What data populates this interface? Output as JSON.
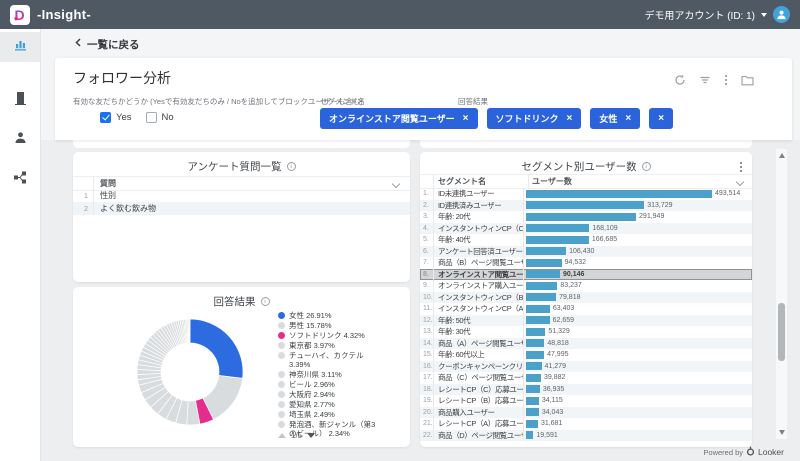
{
  "header": {
    "brand": "-Insight-",
    "account": "デモ用アカウント (ID: 1)"
  },
  "back_link": "一覧に戻る",
  "page": {
    "title": "フォロワー分析"
  },
  "filters": {
    "friend_label": "有効な友だちかどうか (Yesで有効友だちのみ / Noを追加してブロックユーザーも含む)",
    "yes_label": "Yes",
    "no_label": "No",
    "segment_label": "セグメント名",
    "answer_label": "回答結果",
    "chip_color": "#2a63da",
    "chip_close": "×",
    "chips": [
      {
        "label": "オンラインストア閲覧ユーザー"
      },
      {
        "label": "ソフトドリンク"
      },
      {
        "label": "女性"
      },
      {
        "label": ""
      }
    ]
  },
  "questions_panel": {
    "title": "アンケート質問一覧",
    "column": "質問",
    "rows": [
      "性別",
      "よく飲む飲み物"
    ]
  },
  "chart_data": [
    {
      "type": "bar",
      "title": "セグメント別ユーザー数",
      "columns": [
        "セグメント名",
        "ユーザー数"
      ],
      "bar_color": "#4ba1c9",
      "max_value": 493514,
      "selected_row": 8,
      "rows": [
        {
          "name": "ID未連携ユーザー",
          "value": 493514,
          "display": "493,514"
        },
        {
          "name": "ID連携済みユーザー",
          "value": 313729,
          "display": "313,729"
        },
        {
          "name": "年齢: 20代",
          "value": 291949,
          "display": "291,949"
        },
        {
          "name": "インスタントウィンCP（C）参加ユーザー",
          "value": 168109,
          "display": "168,109"
        },
        {
          "name": "年齢: 40代",
          "value": 166685,
          "display": "166,685"
        },
        {
          "name": "アンケート回答済ユーザー",
          "value": 106430,
          "display": "106,430"
        },
        {
          "name": "商品（B）ページ閲覧ユーザー",
          "value": 94532,
          "display": "94,532"
        },
        {
          "name": "オンラインストア閲覧ユーザー",
          "value": 90146,
          "display": "90,146"
        },
        {
          "name": "オンラインストア購入ユーザー",
          "value": 83237,
          "display": "83,237"
        },
        {
          "name": "インスタントウィンCP（B）参加ユーザー",
          "value": 79818,
          "display": "79,818"
        },
        {
          "name": "インスタントウィンCP（A）参加ユーザー",
          "value": 63403,
          "display": "63,403"
        },
        {
          "name": "年齢: 50代",
          "value": 62659,
          "display": "62,659"
        },
        {
          "name": "年齢: 30代",
          "value": 51329,
          "display": "51,329"
        },
        {
          "name": "商品（A）ページ閲覧ユーザー",
          "value": 48818,
          "display": "48,818"
        },
        {
          "name": "年齢: 60代以上",
          "value": 47995,
          "display": "47,995"
        },
        {
          "name": "クーポンキャンペーンクリックユーザー",
          "value": 41279,
          "display": "41,279"
        },
        {
          "name": "商品（C）ページ閲覧ユーザー",
          "value": 39882,
          "display": "39,882"
        },
        {
          "name": "レシートCP（C）応募ユーザー",
          "value": 36935,
          "display": "36,935"
        },
        {
          "name": "レシートCP（B）応募ユーザー",
          "value": 34115,
          "display": "34,115"
        },
        {
          "name": "商品購入ユーザー",
          "value": 34043,
          "display": "34,043"
        },
        {
          "name": "レシートCP（A）応募ユーザー",
          "value": 31681,
          "display": "31,681"
        },
        {
          "name": "商品（D）ページ閲覧ユーザー",
          "value": 19591,
          "display": "19,591"
        }
      ]
    },
    {
      "type": "pie",
      "title": "回答結果",
      "legend": [
        {
          "label": "女性",
          "pct": 26.91,
          "color": "#2c6ce0"
        },
        {
          "label": "男性",
          "pct": 15.78,
          "color": "#d9dcdf"
        },
        {
          "label": "ソフトドリンク",
          "pct": 4.32,
          "color": "#e42d8c"
        },
        {
          "label": "東京都",
          "pct": 3.97,
          "color": "#d9dcdf"
        },
        {
          "label": "チューハイ、カクテル",
          "pct": 3.39,
          "color": "#d9dcdf"
        },
        {
          "label": "神奈川県",
          "pct": 3.11,
          "color": "#d9dcdf"
        },
        {
          "label": "ビール",
          "pct": 2.96,
          "color": "#d9dcdf"
        },
        {
          "label": "大阪府",
          "pct": 2.94,
          "color": "#d9dcdf"
        },
        {
          "label": "愛知県",
          "pct": 2.77,
          "color": "#d9dcdf"
        },
        {
          "label": "埼玉県",
          "pct": 2.49,
          "color": "#d9dcdf"
        },
        {
          "label": "発泡酒、新ジャンル（第3のビール）",
          "pct": 2.34,
          "color": "#d9dcdf"
        }
      ],
      "remainder": {
        "count": 30,
        "total_pct": 29.02,
        "color": "#d9dcdf"
      },
      "pagination": "1/5",
      "hole_ratio": 0.55
    }
  ],
  "footer": {
    "powered_by": "Powered by",
    "brand": "Looker"
  }
}
